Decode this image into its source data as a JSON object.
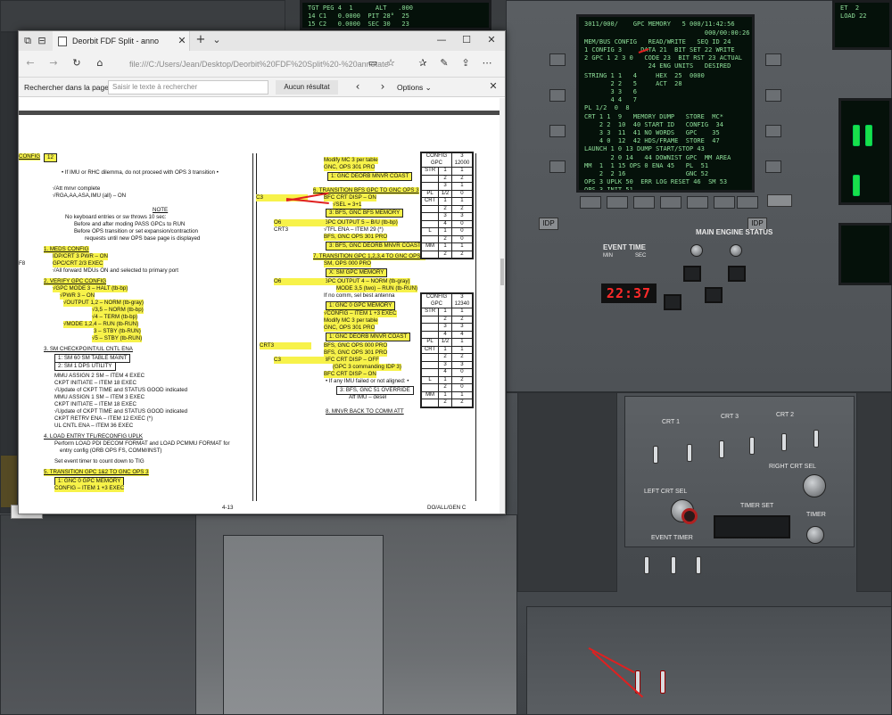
{
  "browser": {
    "tab_title": "Deorbit FDF Split - anno",
    "url": "file:///C:/Users/Jean/Desktop/Deorbit%20FDF%20Split%20-%20annotate",
    "find_label": "Rechercher dans la page",
    "find_placeholder": "Saisir le texte à rechercher",
    "find_result": "Aucun résultat",
    "options_label": "Options"
  },
  "doc_left": [
    {
      "text": "CONFIG",
      "hl": true,
      "u": true
    },
    {
      "text": "• If IMU or RHC dilemma, do not proceed with OPS 3 transition •"
    },
    {
      "text": "√Att mnvr complete"
    },
    {
      "text": "√RGA,AA,ASA,IMU (all) – ON"
    },
    {
      "text": "NOTE",
      "u": true
    },
    {
      "text": "No keyboard entries or sw throws 10 sec:"
    },
    {
      "text": "Before and after moding PASS GPCs to RUN"
    },
    {
      "text": "Before OPS transition or set expansion/contraction"
    },
    {
      "text": "requests until new OPS base page is displayed"
    },
    {
      "text": "1.   MEDS CONFIG",
      "hl": true,
      "u": true
    },
    {
      "text": "IDP/CRT 3 PWR – ON",
      "hl": true
    },
    {
      "text": "GPC/CRT 2/3 EXEC",
      "hl": true
    },
    {
      "text": "√All forward MDUs ON and selected to primary port"
    },
    {
      "text": "2.   VERIFY GPC CONFIG",
      "hl": true,
      "u": true
    },
    {
      "text": "√GPC MODE 3 – HALT (tb-bp)",
      "hl": true
    },
    {
      "text": "√PWR 3 – ON",
      "hl": true
    },
    {
      "text": "√OUTPUT 1,2 – NORM (tb-gray)",
      "hl": true
    },
    {
      "text": "√3,5 – NORM (tb-bp)",
      "hl": true
    },
    {
      "text": "√4   – TERM (tb-bp)",
      "hl": true
    },
    {
      "text": "√MODE 1,2,4 – RUN (tb-RUN)",
      "hl": true
    },
    {
      "text": "3     – STBY (tb-RUN)",
      "hl": true
    },
    {
      "text": "√5     – STBY (tb-RUN)",
      "hl": true
    },
    {
      "text": "3.   SM CHECKPOINT/UL CNTL ENA",
      "u": true
    },
    {
      "text": "1:  SM 60 SM TABLE MAINT"
    },
    {
      "text": "2:  SM 1 DPS UTILITY"
    },
    {
      "text": "MMU ASSIGN 2 SM – ITEM 4 EXEC"
    },
    {
      "text": "CKPT INITIATE – ITEM 18 EXEC"
    },
    {
      "text": "√Update of CKPT TIME and STATUS GOOD indicated"
    },
    {
      "text": "MMU ASSIGN 1 SM – ITEM 3 EXEC"
    },
    {
      "text": "CKPT INITIATE – ITEM 18 EXEC"
    },
    {
      "text": "√Update of CKPT TIME and STATUS GOOD indicated"
    },
    {
      "text": "CKPT RETRV ENA – ITEM 12 EXEC (*)"
    },
    {
      "text": "UL CNTL ENA – ITEM 36 EXEC"
    },
    {
      "text": "4.   LOAD ENTRY TFL/RECONFIG UPLK",
      "u": true
    },
    {
      "text": "Perform LOAD PDI DECOM FORMAT and LOAD PCMMU FORMAT for"
    },
    {
      "text": "entry config (ORB OPS FS, COMM/INST)"
    },
    {
      "text": "Set event timer to count down to TIG"
    },
    {
      "text": "5.   TRANSITION GPC 1&2 TO GNC OPS 3",
      "hl": true,
      "u": true
    },
    {
      "text": "1:  GNC 0 GPC MEMORY",
      "hl": true
    },
    {
      "text": "CONFIG – ITEM 1 +3 EXEC",
      "hl": true
    }
  ],
  "doc_left_extra": {
    "config_value": "12",
    "f8": "F8",
    "page_no": "4-13"
  },
  "doc_right": [
    {
      "text": "Modify MC 3 per table",
      "hl": true
    },
    {
      "text": "GNC, OPS 301 PRO",
      "hl": true
    },
    {
      "text": "1:  GNC DEORB MNVR COAST",
      "hl": true
    },
    {
      "text": "6.   TRANSITION BFS GPC TO GNC OPS 3",
      "hl": true,
      "u": true
    },
    {
      "text": "BFC CRT DISP – ON",
      "hl": true
    },
    {
      "text": "√SEL = 3+1",
      "hl": true
    },
    {
      "text": "3:  BFS, GNC BFS MEMORY",
      "hl": true
    },
    {
      "text": "GPC OUTPUT 5 – B/U (tb-bp)",
      "hl": true
    },
    {
      "text": "√TFL ENA – ITEM 29 (*)"
    },
    {
      "text": "BFS, GNC OPS 301 PRO",
      "hl": true
    },
    {
      "text": "3:  BFS, GNC DEORB MNVR COAST",
      "hl": true
    },
    {
      "text": "7.   TRANSITION GPC 1,2,3,4 TO GNC OPS 3",
      "hl": true,
      "u": true
    },
    {
      "text": "SM, OPS 000 PRO",
      "hl": true
    },
    {
      "text": "X:  SM GPC MEMORY",
      "hl": true
    },
    {
      "text": "GPC OUTPUT 4 – NORM (tb-gray)",
      "hl": true
    },
    {
      "text": "MODE 3,5 (two) – RUN (tb-RUN)",
      "hl": true
    },
    {
      "text": "If no comm, sel best antenna"
    },
    {
      "text": "1:  GNC 0 GPC MEMORY",
      "hl": true
    },
    {
      "text": "√CONFIG – ITEM 1 +3 EXEC",
      "hl": true
    },
    {
      "text": "Modify MC 3 per table",
      "hl": true
    },
    {
      "text": "GNC, OPS 301 PRO",
      "hl": true
    },
    {
      "text": "1:  GNC DEORB MNVR COAST",
      "hl": true
    },
    {
      "text": "BFS, GNC OPS 000 PRO",
      "hl": true
    },
    {
      "text": "BFS, GNC OPS 301 PRO",
      "hl": true
    },
    {
      "text": "BFC CRT DISP – OFF",
      "hl": true
    },
    {
      "text": "(GPC 3 commanding IDP 3)",
      "hl": true
    },
    {
      "text": "BFC CRT DISP – ON",
      "hl": true
    },
    {
      "text": "• If any IMU failed or not aligned: •"
    },
    {
      "text": "3:  BFS, GNC 51 OVERRIDE"
    },
    {
      "text": "Aff IMU – desel"
    },
    {
      "text": "8.   MNVR BACK TO COMM ATT",
      "u": true
    }
  ],
  "doc_right_labels": [
    "C3",
    "O6",
    "CRT3",
    "O6",
    "CRT3",
    "C3"
  ],
  "config_tables": [
    {
      "hdr": [
        "CONFIG GPC",
        "3",
        "12000"
      ],
      "rows": [
        [
          "STR",
          "1",
          "1"
        ],
        [
          "",
          "2",
          "2"
        ],
        [
          "",
          "3",
          "1"
        ],
        [
          "PL",
          "1/2",
          "0"
        ],
        [
          "CRT",
          "1",
          "1"
        ],
        [
          "",
          "2",
          "2"
        ],
        [
          "",
          "3",
          "3"
        ],
        [
          "",
          "4",
          "0"
        ],
        [
          "L",
          "1",
          "0"
        ],
        [
          "",
          "2",
          "0"
        ],
        [
          "MM",
          "1",
          "1"
        ],
        [
          "",
          "2",
          "2"
        ]
      ]
    },
    {
      "hdr": [
        "CONFIG GPC",
        "3",
        "12340"
      ],
      "rows": [
        [
          "STR",
          "1",
          "1"
        ],
        [
          "",
          "2",
          "2"
        ],
        [
          "",
          "3",
          "3"
        ],
        [
          "",
          "4",
          "4"
        ],
        [
          "PL",
          "1/2",
          "1"
        ],
        [
          "CRT",
          "1",
          "1"
        ],
        [
          "",
          "2",
          "2"
        ],
        [
          "",
          "3",
          "3"
        ],
        [
          "",
          "4",
          "0"
        ],
        [
          "L",
          "1",
          "2"
        ],
        [
          "",
          "2",
          "0"
        ],
        [
          "MM",
          "1",
          "1"
        ],
        [
          "",
          "2",
          "2"
        ]
      ]
    }
  ],
  "footer_right": "DO/ALL/GEN C",
  "cockpit": {
    "event_time": "EVENT TIME",
    "min": "MIN",
    "sec": "SEC",
    "time_value": "22:37",
    "main_engine_status": "MAIN ENGINE STATUS",
    "timer_set": "TIMER SET",
    "timer": "TIMER",
    "event_timer": "EVENT TIMER",
    "gpc_memory": "GPC MEMORY",
    "close": "Close",
    "left_crt_sel": "LEFT CRT SEL",
    "right_crt_sel": "RIGHT CRT SEL",
    "crt1": "CRT 1",
    "crt3": "CRT 3",
    "crt2": "CRT 2"
  }
}
